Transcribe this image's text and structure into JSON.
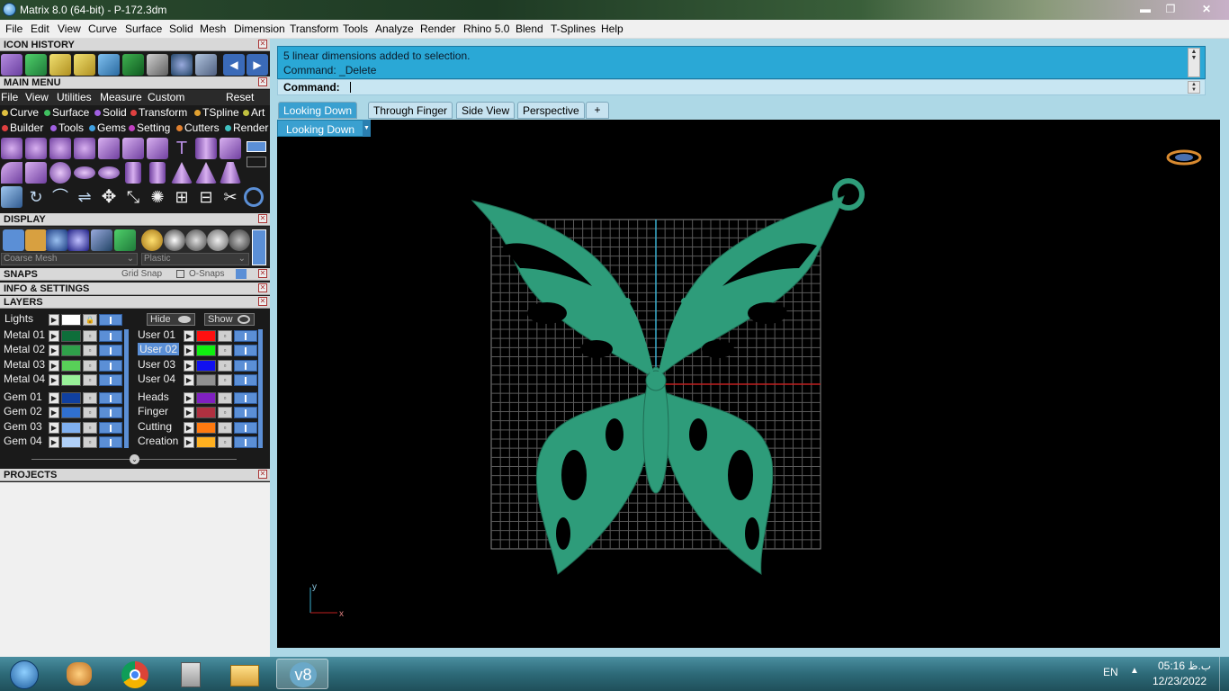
{
  "window": {
    "title": "Matrix 8.0 (64-bit) - P-172.3dm",
    "min": "▬",
    "max": "❐",
    "close": "✕"
  },
  "menubar": [
    "File",
    "Edit",
    "View",
    "Curve",
    "Surface",
    "Solid",
    "Mesh",
    "Dimension",
    "Transform",
    "Tools",
    "Analyze",
    "Render",
    "Rhino 5.0",
    "Blend",
    "T-Splines",
    "Help"
  ],
  "panels": {
    "icon_history": "ICON HISTORY",
    "main_menu": "MAIN MENU",
    "display": "DISPLAY",
    "snaps": "SNAPS",
    "grid_snap": "Grid Snap",
    "o_snaps": "O-Snaps",
    "info_settings": "INFO & SETTINGS",
    "layers": "LAYERS",
    "projects": "PROJECTS"
  },
  "main_menu": {
    "row1": [
      "File",
      "View",
      "Utilities",
      "Measure",
      "Custom"
    ],
    "reset": "Reset",
    "row2": [
      {
        "label": "Curve",
        "color": "#e0c040"
      },
      {
        "label": "Surface",
        "color": "#40c060"
      },
      {
        "label": "Solid",
        "color": "#a060e0"
      },
      {
        "label": "Transform",
        "color": "#e04040"
      },
      {
        "label": "TSpline",
        "color": "#e0a030"
      },
      {
        "label": "Art",
        "color": "#c0c040"
      }
    ],
    "row3": [
      {
        "label": "Builder",
        "color": "#e04040"
      },
      {
        "label": "Tools",
        "color": "#a060e0"
      },
      {
        "label": "Gems",
        "color": "#40a0e0"
      },
      {
        "label": "Setting",
        "color": "#c040c0"
      },
      {
        "label": "Cutters",
        "color": "#e08030"
      },
      {
        "label": "Render",
        "color": "#40c0c0"
      }
    ]
  },
  "display": {
    "mesh_select": "Coarse Mesh",
    "material_select": "Plastic"
  },
  "layers": {
    "lights_label": "Lights",
    "lights_color": "#ffffff",
    "hide_label": "Hide",
    "show_label": "Show",
    "left_group1": [
      {
        "name": "Metal 01",
        "color": "#0e6e3a"
      },
      {
        "name": "Metal 02",
        "color": "#2fa04a"
      },
      {
        "name": "Metal 03",
        "color": "#58d058"
      },
      {
        "name": "Metal 04",
        "color": "#98f098"
      }
    ],
    "right_group1": [
      {
        "name": "User 01",
        "color": "#ff1010"
      },
      {
        "name": "User 02",
        "color": "#10f010"
      },
      {
        "name": "User 03",
        "color": "#1010f0"
      },
      {
        "name": "User 04",
        "color": "#909090"
      }
    ],
    "left_group2": [
      {
        "name": "Gem 01",
        "color": "#1040a0"
      },
      {
        "name": "Gem 02",
        "color": "#3070d0"
      },
      {
        "name": "Gem 03",
        "color": "#80b0f0"
      },
      {
        "name": "Gem 04",
        "color": "#b0d0f8"
      }
    ],
    "right_group2": [
      {
        "name": "Heads",
        "color": "#8020c0"
      },
      {
        "name": "Finger",
        "color": "#b03040"
      },
      {
        "name": "Cutting",
        "color": "#ff7a10"
      },
      {
        "name": "Creation",
        "color": "#ffb020"
      }
    ]
  },
  "command": {
    "history_line1": "5 linear dimensions added to selection.",
    "history_line2": "Command: _Delete",
    "prompt_label": "Command:"
  },
  "tabs": [
    "Looking Down",
    "Through Finger",
    "Side View",
    "Perspective"
  ],
  "tab_add": "+",
  "viewport": {
    "name": "Looking Down",
    "axis_x": "x",
    "axis_y": "y",
    "model_color": "#2e9c7a"
  },
  "taskbar": {
    "lang": "EN",
    "time": "05:16 ب.ظ",
    "date": "12/23/2022"
  }
}
